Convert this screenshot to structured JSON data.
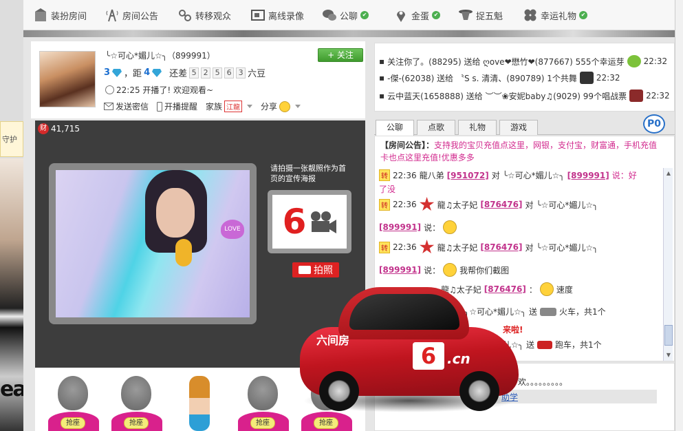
{
  "toolbar": {
    "items": [
      {
        "label": "装扮房间",
        "icon": "room-dress-icon",
        "check": false
      },
      {
        "label": "房间公告",
        "icon": "announcement-tower-icon",
        "check": false
      },
      {
        "label": "转移观众",
        "icon": "link-transfer-icon",
        "check": false
      },
      {
        "label": "离线录像",
        "icon": "video-record-icon",
        "check": false
      },
      {
        "label": "公聊",
        "icon": "chat-bubble-icon",
        "check": true
      },
      {
        "label": "金蛋",
        "icon": "location-pin-icon",
        "check": true
      },
      {
        "label": "捉五魁",
        "icon": "hat-icon",
        "check": false
      },
      {
        "label": "幸运礼物",
        "icon": "clover-icon",
        "check": true
      }
    ]
  },
  "left_tip": "守护",
  "anchor": {
    "name": "╰☆可心*媚儿☆╮（899991）",
    "follow_label": "+ 关注",
    "level_current": "3",
    "level_sep": "，距",
    "level_next": "4",
    "level_gap_label": "还差",
    "level_gap_digits": [
      "5",
      "2",
      "5",
      "6",
      "3"
    ],
    "level_gap_unit": "六豆",
    "live_text": "22:25 开播了! 欢迎观看~",
    "actions": {
      "message": "发送密信",
      "remind": "开播提醒",
      "family": "家族",
      "family_tag": "江龍",
      "share": "分享"
    }
  },
  "video": {
    "wealth_icon": "财",
    "wealth_value": "41,715",
    "love_badge": "LOVE",
    "poster_hint": "请拍摄一张靓照作为首页的宣传海报",
    "poster_logo": "6",
    "photo_button": "拍照"
  },
  "seats": {
    "grab_label": "抢座"
  },
  "gift_feed": [
    {
      "text": "关注你了。(88295) 送给 ღove❤懋竹❤(877667) 555个幸运芽",
      "time": "22:32",
      "gift_color": "#7cc23a"
    },
    {
      "text": "-傑-(62038) 送给 〝S s. 清清、(890789) 1个共舞",
      "time": "22:32",
      "gift_color": "#333333"
    },
    {
      "text": "云中蓝天(1658888) 送给 ︶︶❀安妮baby♫(9029) 99个唱战票",
      "time": "22:32",
      "gift_color": "#8b2a2a"
    }
  ],
  "tabs": [
    "公聊",
    "点歌",
    "礼物",
    "游戏"
  ],
  "p_badge": "P0",
  "chat": {
    "notice_label": "【房间公告】：",
    "notice_text": "支持我的宝贝充值点这里，网银，支付宝，财富通，手机充值卡也点这里充值!优惠多多",
    "messages": [
      {
        "tag": "转",
        "time": "22:36",
        "user": "龍八弟",
        "uid": "[951072]",
        "to_word": "对",
        "target": "╰☆可心*媚儿☆╮",
        "tuid": "[899991]",
        "said": "说：好",
        "cont": "了没"
      },
      {
        "tag": "转",
        "time": "22:36",
        "user": "龍♫太子妃",
        "uid": "[876476]",
        "to_word": "对",
        "target": "╰☆可心*媚儿☆╮",
        "tuid": "[899991]",
        "said": "说："
      },
      {
        "tag": "转",
        "time": "22:36",
        "user": "龍♫太子妃",
        "uid": "[876476]",
        "to_word": "对",
        "target": "╰☆可心*媚儿☆╮",
        "tuid": "[899991]",
        "said": "说：",
        "extra": "我帮你们截图"
      },
      {
        "user": "龍♫太子妃",
        "uid": "[876476]",
        "said": "：",
        "extra": "速度"
      },
      {
        "target": "╮☆可心*媚儿☆╮",
        "send": "送",
        "gift": "火车，共1个"
      },
      {
        "alert": "来啦!"
      },
      {
        "target": "儿☆╮",
        "send": "送",
        "gift": "跑车，共1个"
      }
    ]
  },
  "bottom": {
    "marquee": "欢。。。。。。。。。",
    "link": "助学"
  },
  "car_overlay": {
    "number": "6",
    "brand": ".cn",
    "side_text": "六间房"
  }
}
